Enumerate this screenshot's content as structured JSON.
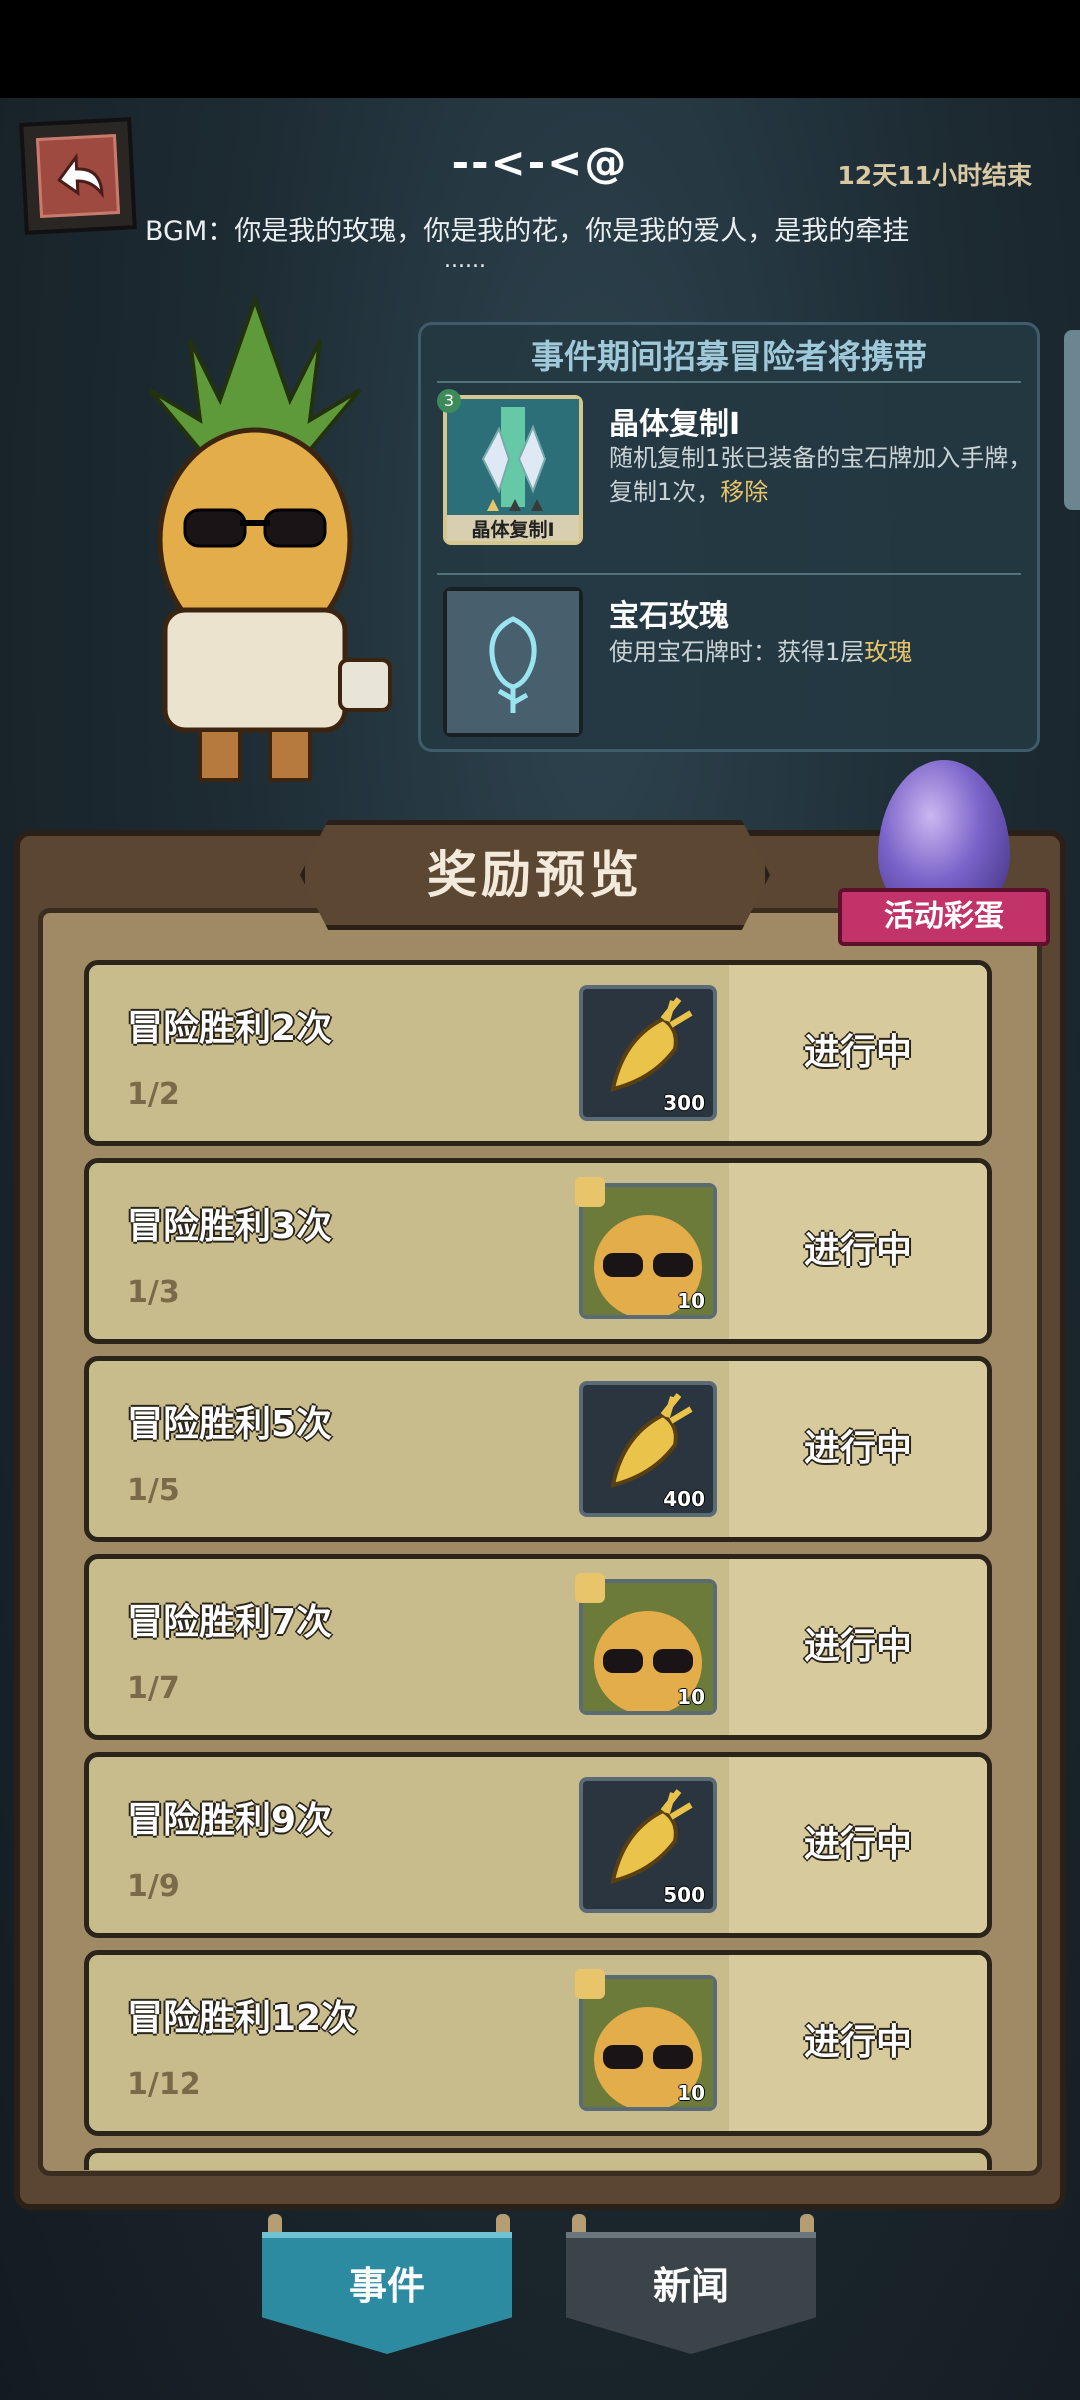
{
  "header": {
    "title": "--<-<@",
    "timer": "12天11小时结束",
    "bgm_line": "BGM：你是我的玫瑰，你是我的花，你是我的爱人，是我的牵挂",
    "bgm_ellipsis": "......"
  },
  "event_panel": {
    "heading": "事件期间招募冒险者将携带",
    "items": [
      {
        "name": "晶体复制I",
        "desc_prefix": "随机复制1张已装备的宝石牌加入手牌，复制1次，",
        "desc_highlight": "移除",
        "icon_caption": "晶体复制I",
        "level_badge": "3"
      },
      {
        "name": "宝石玫瑰",
        "desc_prefix": "使用宝石牌时：获得1层",
        "desc_highlight": "玫瑰"
      }
    ]
  },
  "rewards": {
    "banner_title": "奖励预览",
    "egg_label": "活动彩蛋",
    "rows": [
      {
        "title": "冒险胜利2次",
        "progress": "1/2",
        "reward_type": "carrot",
        "count": "300",
        "status": "进行中"
      },
      {
        "title": "冒险胜利3次",
        "progress": "1/3",
        "reward_type": "pineapple-hero",
        "count": "10",
        "status": "进行中"
      },
      {
        "title": "冒险胜利5次",
        "progress": "1/5",
        "reward_type": "carrot",
        "count": "400",
        "status": "进行中"
      },
      {
        "title": "冒险胜利7次",
        "progress": "1/7",
        "reward_type": "pineapple-hero",
        "count": "10",
        "status": "进行中"
      },
      {
        "title": "冒险胜利9次",
        "progress": "1/9",
        "reward_type": "carrot",
        "count": "500",
        "status": "进行中"
      },
      {
        "title": "冒险胜利12次",
        "progress": "1/12",
        "reward_type": "pineapple-hero",
        "count": "10",
        "status": "进行中"
      }
    ]
  },
  "bottom_tabs": {
    "events_label": "事件",
    "news_label": "新闻"
  }
}
